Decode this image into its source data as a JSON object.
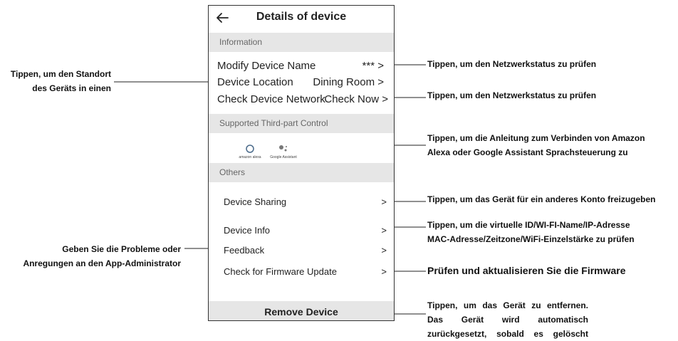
{
  "header": {
    "back_icon": "arrow-left-icon",
    "title": "Details of device"
  },
  "sections": {
    "information": "Information",
    "third_party": "Supported Third-part Control",
    "others": "Others"
  },
  "rows": {
    "modify_name": {
      "label": "Modify Device Name",
      "value": "*** >"
    },
    "location": {
      "label": "Device Location",
      "value": "Dining Room >"
    },
    "network": {
      "label": "Check Device Network",
      "value": "Check Now >"
    },
    "sharing": {
      "label": "Device Sharing",
      "value": ">"
    },
    "info": {
      "label": "Device Info",
      "value": ">"
    },
    "feedback": {
      "label": "Feedback",
      "value": ">"
    },
    "firmware": {
      "label": "Check for Firmware Update",
      "value": ">"
    }
  },
  "logos": {
    "alexa": "amazon alexa",
    "google": "Google Assistant"
  },
  "remove_label": "Remove Device",
  "annotations": {
    "location": [
      "Tippen, um den Standort",
      "des Geräts in einen"
    ],
    "modify_name": "Tippen, um den Netzwerkstatus zu prüfen",
    "network": "Tippen, um den Netzwerkstatus zu prüfen",
    "third_party": [
      "Tippen, um die Anleitung zum Verbinden von Amazon",
      "Alexa oder Google Assistant Sprachsteuerung zu"
    ],
    "sharing": "Tippen, um das Gerät für ein anderes Konto freizugeben",
    "info": [
      "Tippen, um die virtuelle ID/WI-FI-Name/IP-Adresse",
      "MAC-Adresse/Zeitzone/WiFi-Einzelstärke zu prüfen"
    ],
    "feedback": [
      "Geben Sie die Probleme oder",
      "Anregungen an den App-Administrator"
    ],
    "firmware": "Prüfen und aktualisieren Sie die Firmware",
    "remove": [
      "Tippen, um das Gerät zu entfernen.",
      "Das Gerät wird automatisch",
      "zurückgesetzt, sobald es gelöscht"
    ]
  }
}
